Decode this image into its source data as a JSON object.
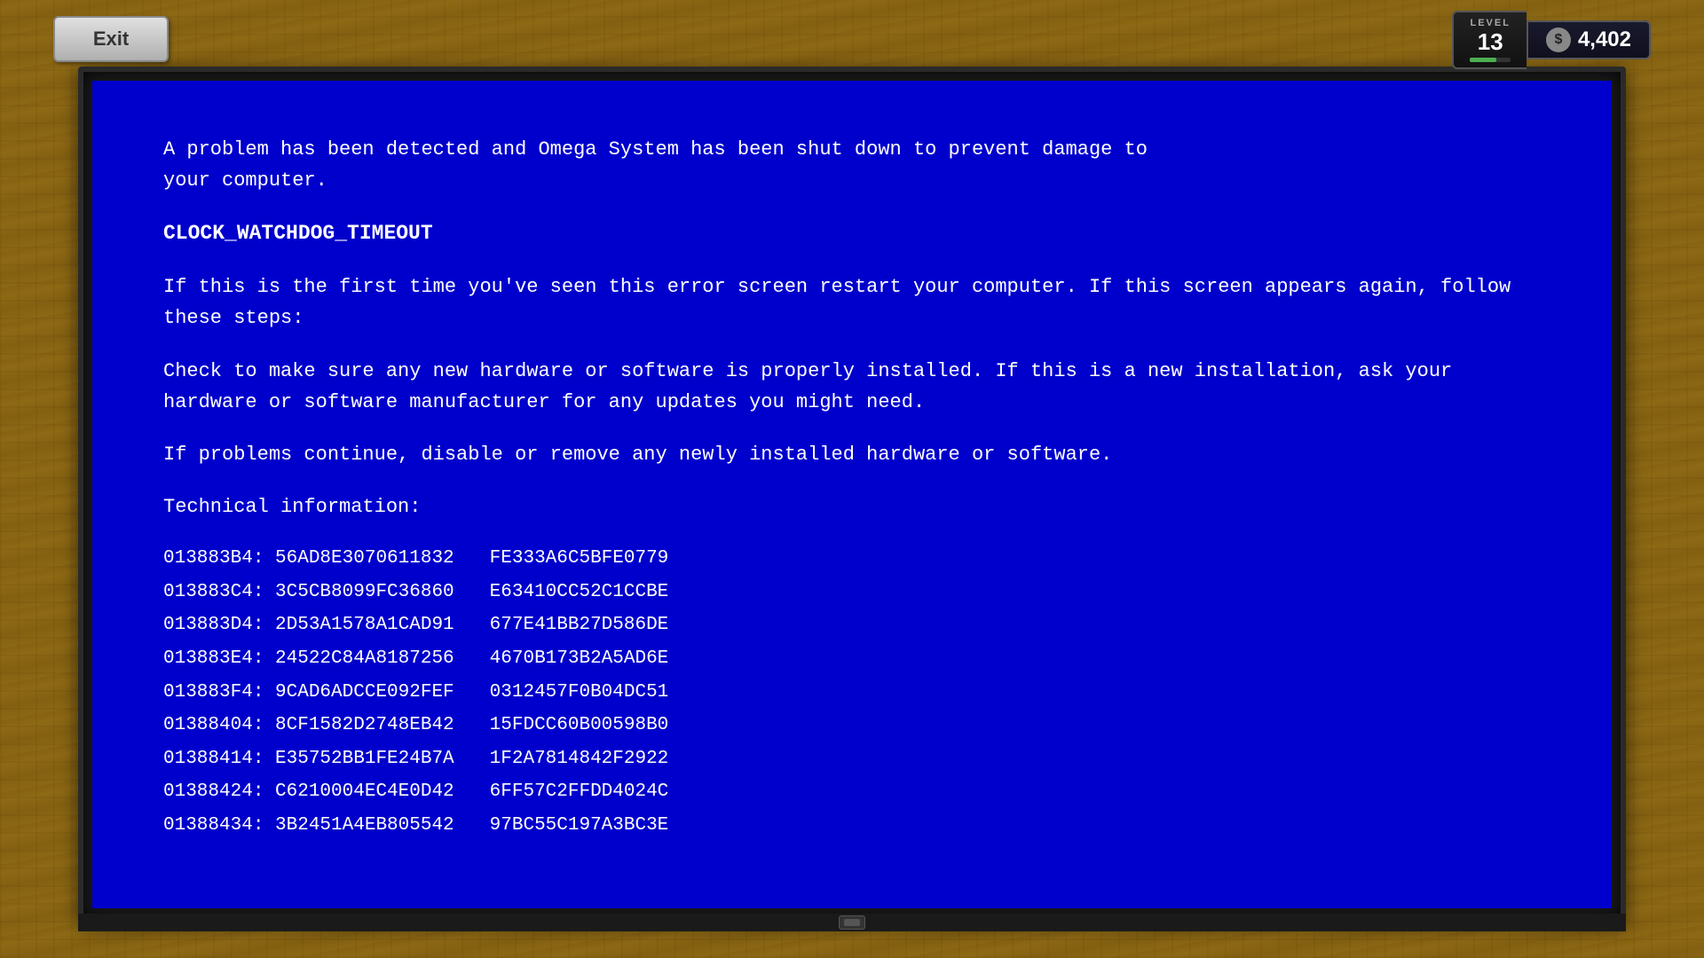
{
  "exit_button": {
    "label": "Exit"
  },
  "hud": {
    "level_label": "LEVEL",
    "level_value": "13",
    "level_bar_percent": 65,
    "dollar_symbol": "$",
    "money_value": "4,402"
  },
  "bsod": {
    "line1": "A problem has been detected and Omega System has been shut down to prevent damage to",
    "line2": "your computer.",
    "error_code": "CLOCK_WATCHDOG_TIMEOUT",
    "paragraph2": "If this is the first time you've seen this error screen restart your computer. If this screen appears again, follow these steps:",
    "paragraph3": "Check to make sure any new hardware or software is properly installed. If this is a new installation, ask your hardware or software manufacturer for any updates you might need.",
    "paragraph4": "If problems continue, disable or remove any newly installed hardware or software.",
    "tech_label": "Technical information:",
    "tech_rows": [
      {
        "addr": "013883B4:",
        "val1": "56AD8E3070611832",
        "val2": "FE333A6C5BFE0779"
      },
      {
        "addr": "013883C4:",
        "val1": "3C5CB8099FC36860",
        "val2": "E63410CC52C1CCBE"
      },
      {
        "addr": "013883D4:",
        "val1": "2D53A1578A1CAD91",
        "val2": "677E41BB27D586DE"
      },
      {
        "addr": "013883E4:",
        "val1": "24522C84A8187256",
        "val2": "4670B173B2A5AD6E"
      },
      {
        "addr": "013883F4:",
        "val1": "9CAD6ADCCE092FEF",
        "val2": "0312457F0B04DC51"
      },
      {
        "addr": "01388404:",
        "val1": "8CF1582D2748EB42",
        "val2": "15FDCC60B00598B0"
      },
      {
        "addr": "01388414:",
        "val1": "E35752BB1FE24B7A",
        "val2": "1F2A7814842F2922"
      },
      {
        "addr": "01388424:",
        "val1": "C6210004EC4E0D42",
        "val2": "6FF57C2FFDD4024C"
      },
      {
        "addr": "01388434:",
        "val1": "3B2451A4EB805542",
        "val2": "97BC55C197A3BC3E"
      }
    ]
  }
}
